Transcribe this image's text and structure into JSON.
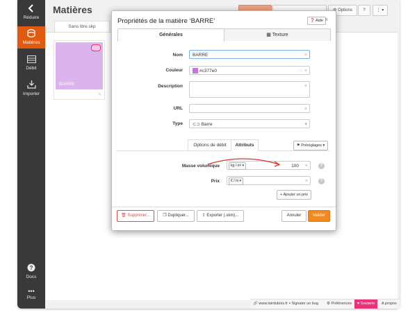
{
  "sidebar": {
    "reduce": "Réduire",
    "materials": "Matières",
    "debit": "Débit",
    "import": "Importer",
    "docs": "Docs",
    "more": "Plus"
  },
  "header": {
    "title": "Matières",
    "options": "Options",
    "file_tab": "Sans titre.skp"
  },
  "material_card": {
    "label": "BARRE",
    "color": "#dcb3ec"
  },
  "footer": {
    "site": "www.lairdubois.fr",
    "bug": "Signaler un bug",
    "prefs": "Préférences",
    "support": "Soutenir",
    "about": "A propos"
  },
  "modal": {
    "title": "Propriétés de la matière ‘BARRE’",
    "help": "Aide",
    "tabs": {
      "general": "Générales",
      "texture": "Texture"
    },
    "fields": {
      "name_label": "Nom",
      "name_value": "BARRE",
      "color_label": "Couleur",
      "color_value": "#c377e0",
      "desc_label": "Description",
      "url_label": "URL",
      "type_label": "Type",
      "type_value": "Barre"
    },
    "subtabs": {
      "debit_options": "Options de débit",
      "attributes": "Attributs",
      "presets": "Préréglages"
    },
    "attributes": {
      "mass_label": "Masse volumique",
      "mass_unit": "kg / m³",
      "mass_value": "100",
      "price_label": "Prix",
      "price_unit": "€ / m",
      "add_price": "Ajouter un prix"
    },
    "buttons": {
      "delete": "Supprimer...",
      "duplicate": "Dupliquer...",
      "export": "Exporter (.skm)...",
      "cancel": "Annuler",
      "validate": "Valider"
    }
  },
  "colors": {
    "accent": "#e05a10",
    "validate": "#f0891e",
    "swatch": "#c377e0",
    "delete": "#d9534f"
  }
}
